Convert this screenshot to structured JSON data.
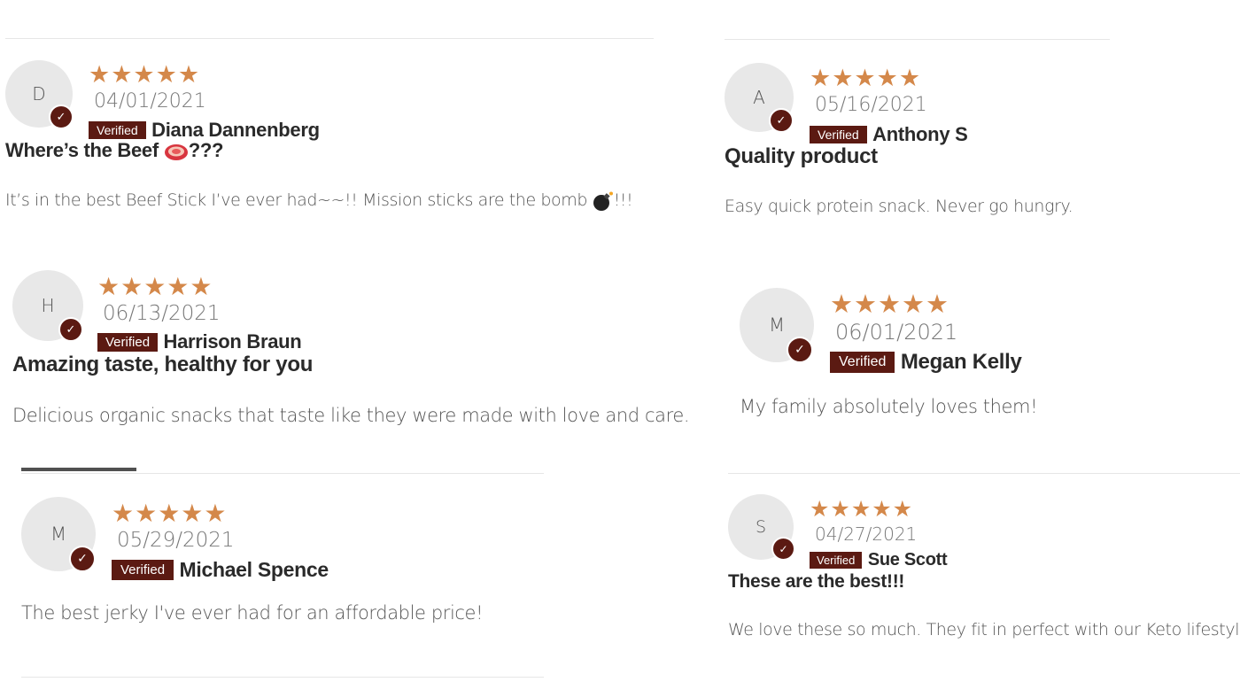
{
  "colors": {
    "star": "#d4884a",
    "badge": "#5b1a12",
    "avatar_bg": "#e8e8e8"
  },
  "reviews": [
    {
      "initial": "D",
      "stars": "★★★★★",
      "date": "04/01/2021",
      "badge": "Verified",
      "name": "Diana Dannenberg",
      "title_pre": "Where’s the Beef",
      "title_emoji": "steak-icon",
      "title_post": "???",
      "body_pre": "It’s in the best Beef Stick I’ve ever had~~!! Mission sticks are the bomb",
      "body_emoji": "bomb-icon",
      "body_post": "!!!"
    },
    {
      "initial": "H",
      "stars": "★★★★★",
      "date": "06/13/2021",
      "badge": "Verified",
      "name": "Harrison Braun",
      "title": "Amazing taste, healthy for you",
      "body": "Delicious organic snacks that taste like they were made with love and care."
    },
    {
      "initial": "M",
      "stars": "★★★★★",
      "date": "05/29/2021",
      "badge": "Verified",
      "name": "Michael Spence",
      "body": "The best jerky I've ever had for an affordable price!"
    },
    {
      "initial": "A",
      "stars": "★★★★★",
      "date": "05/16/2021",
      "badge": "Verified",
      "name": "Anthony S",
      "title": "Quality product",
      "body": "Easy quick protein snack. Never go hungry."
    },
    {
      "initial": "M",
      "stars": "★★★★★",
      "date": "06/01/2021",
      "badge": "Verified",
      "name": "Megan Kelly",
      "body": "My family absolutely loves them!"
    },
    {
      "initial": "S",
      "stars": "★★★★★",
      "date": "04/27/2021",
      "badge": "Verified",
      "name": "Sue Scott",
      "title": "These are the best!!!",
      "body": "We love these so much. They fit in perfect with our Keto lifestyle."
    }
  ]
}
